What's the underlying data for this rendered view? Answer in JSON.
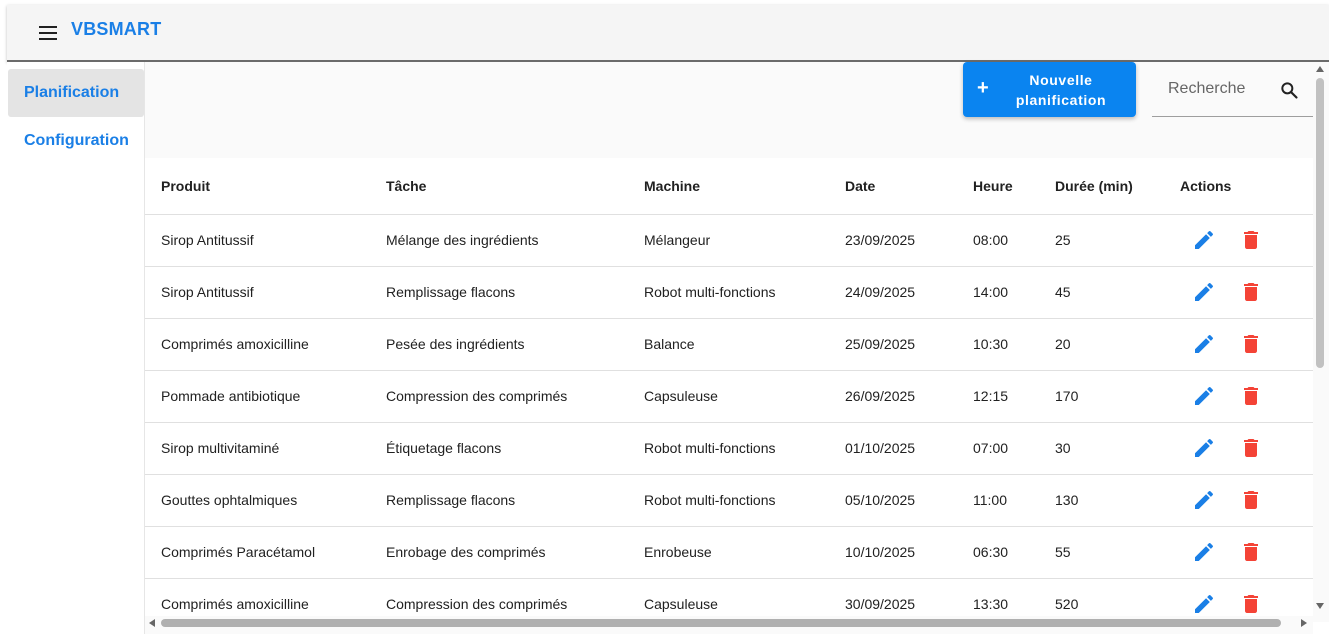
{
  "app": {
    "brand": "VBSMART",
    "menu_icon": "menu-icon"
  },
  "sidebar": {
    "items": [
      {
        "label": "Planification",
        "active": true
      },
      {
        "label": "Configuration",
        "active": false
      }
    ]
  },
  "toolbar": {
    "new_button": {
      "icon": "plus-icon",
      "line1": "Nouvelle",
      "line2": "planification"
    },
    "search": {
      "placeholder": "Recherche",
      "value": "",
      "icon": "search-icon"
    }
  },
  "colors": {
    "accent": "#1a7fe6",
    "button": "#0a84f0",
    "edit": "#1a7fe6",
    "delete": "#f44336"
  },
  "table": {
    "columns": [
      "Produit",
      "Tâche",
      "Machine",
      "Date",
      "Heure",
      "Durée (min)",
      "Actions"
    ],
    "row_actions": [
      "edit-icon",
      "delete-icon"
    ],
    "rows": [
      [
        "Sirop Antitussif",
        "Mélange des ingrédients",
        "Mélangeur",
        "23/09/2025",
        "08:00",
        "25"
      ],
      [
        "Sirop Antitussif",
        "Remplissage flacons",
        "Robot multi-fonctions",
        "24/09/2025",
        "14:00",
        "45"
      ],
      [
        "Comprimés amoxicilline",
        "Pesée des ingrédients",
        "Balance",
        "25/09/2025",
        "10:30",
        "20"
      ],
      [
        "Pommade antibiotique",
        "Compression des comprimés",
        "Capsuleuse",
        "26/09/2025",
        "12:15",
        "170"
      ],
      [
        "Sirop multivitaminé",
        "Étiquetage flacons",
        "Robot multi-fonctions",
        "01/10/2025",
        "07:00",
        "30"
      ],
      [
        "Gouttes ophtalmiques",
        "Remplissage flacons",
        "Robot multi-fonctions",
        "05/10/2025",
        "11:00",
        "130"
      ],
      [
        "Comprimés Paracétamol",
        "Enrobage des comprimés",
        "Enrobeuse",
        "10/10/2025",
        "06:30",
        "55"
      ],
      [
        "Comprimés amoxicilline",
        "Compression des comprimés",
        "Capsuleuse",
        "30/09/2025",
        "13:30",
        "520"
      ]
    ]
  }
}
